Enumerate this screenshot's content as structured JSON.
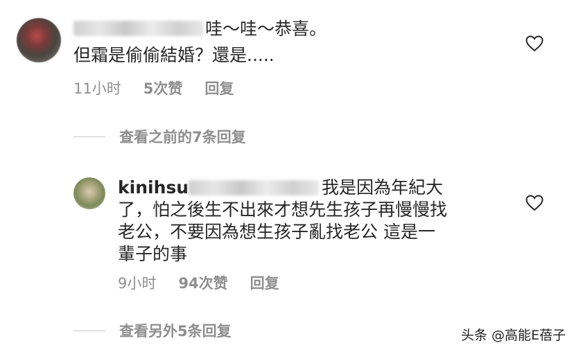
{
  "comments": [
    {
      "text_line1": "哇～哇～恭喜。",
      "text_line2": "但霜是偷偷結婚？還是.....",
      "time": "11小时",
      "likes": "5次赞",
      "reply": "回复"
    },
    {
      "username": "kinihsu",
      "text_line1": "我是因為年紀大",
      "text_line2": "了，怕之後生不出來才想先生孩子再慢慢找",
      "text_line3": "老公，不要因為想生孩子亂找老公 這是一",
      "text_line4": "輩子的事",
      "time": "9小时",
      "likes": "94次赞",
      "reply": "回复"
    }
  ],
  "view_more": [
    {
      "label": "查看之前的7条回复"
    },
    {
      "label": "查看另外5条回复"
    }
  ],
  "watermark": "头条 @高能E蓓子",
  "icons": {
    "like": "heart-icon"
  },
  "colors": {
    "text": "#262626",
    "secondary": "#8e8e8e",
    "divider": "#c7c7c7"
  }
}
